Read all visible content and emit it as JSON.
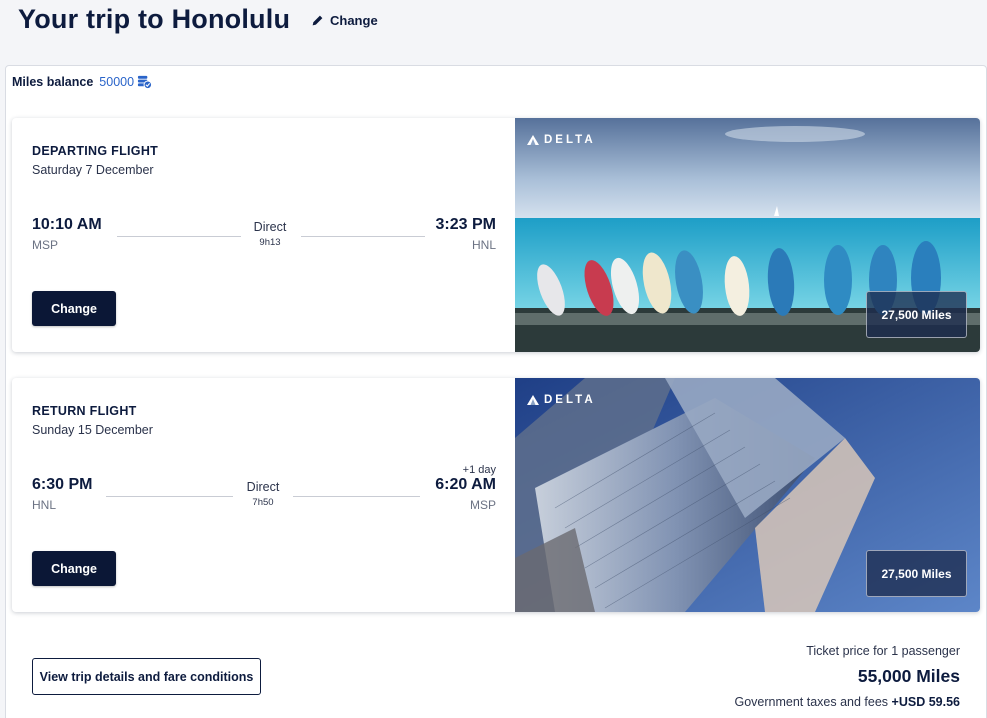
{
  "page": {
    "title": "Your trip to Honolulu",
    "change_label": "Change"
  },
  "balance": {
    "label": "Miles balance",
    "value": "50000"
  },
  "flights": [
    {
      "kind": "DEPARTING FLIGHT",
      "date": "Saturday 7 December",
      "depart_time": "10:10 AM",
      "depart_code": "MSP",
      "arrive_time": "3:23 PM",
      "arrive_code": "HNL",
      "day_offset": "",
      "stops": "Direct",
      "duration": "9h13",
      "change_label": "Change",
      "airline": "DELTA",
      "price": "27,500 Miles",
      "photo": "beach-surfboards"
    },
    {
      "kind": "RETURN FLIGHT",
      "date": "Sunday 15 December",
      "depart_time": "6:30 PM",
      "depart_code": "HNL",
      "arrive_time": "6:20 AM",
      "arrive_code": "MSP",
      "day_offset": "+1 day",
      "stops": "Direct",
      "duration": "7h50",
      "change_label": "Change",
      "airline": "DELTA",
      "price": "27,500 Miles",
      "photo": "city-skyscrapers"
    }
  ],
  "footer": {
    "details_label": "View trip details and fare conditions",
    "price_caption": "Ticket price for 1 passenger",
    "total": "55,000 Miles",
    "taxes_label": "Government taxes and fees",
    "taxes_value": "+USD 59.56"
  },
  "colors": {
    "primary": "#0b1736",
    "link": "#2a64c9",
    "background": "#f4f5f8"
  },
  "icons": [
    "pencil-icon",
    "miles-icon",
    "delta-logo-icon"
  ]
}
